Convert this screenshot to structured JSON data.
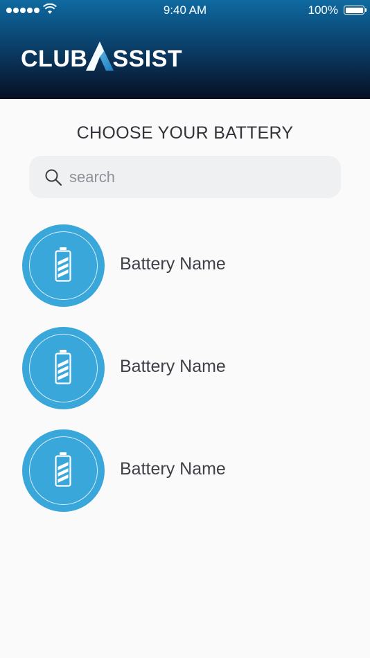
{
  "status_bar": {
    "time": "9:40 AM",
    "battery_percent": "100%",
    "signal_dots": 5
  },
  "header": {
    "logo_left": "CLUB",
    "logo_right": "SSIST",
    "logo_mark_icon": "triangle-a-mark-icon",
    "gradient_top": "#0f6aa0",
    "gradient_bottom": "#050f22"
  },
  "page": {
    "title": "CHOOSE YOUR BATTERY"
  },
  "search": {
    "placeholder": "search",
    "value": "",
    "icon": "search-icon"
  },
  "batteries": [
    {
      "name": "Battery Name",
      "icon": "battery-icon"
    },
    {
      "name": "Battery Name",
      "icon": "battery-icon"
    },
    {
      "name": "Battery Name",
      "icon": "battery-icon"
    }
  ],
  "colors": {
    "accent": "#3aa7db",
    "background": "#fafafa",
    "search_bg": "#eef0f2",
    "text": "#3f4048"
  }
}
